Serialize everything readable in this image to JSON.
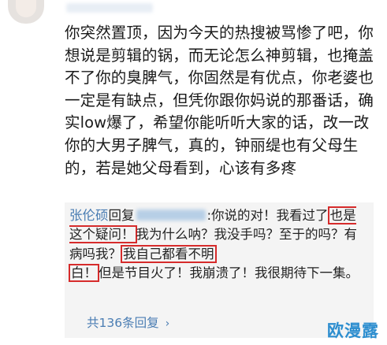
{
  "post": {
    "text": "你突然置顶，因为今天的热搜被骂惨了吧，你想说是剪辑的锅，而无论怎么神剪辑，也掩盖不了你的臭脾气，你固然是有优点，你老婆也一定是有缺点，但凭你跟你妈说的那番话，确实low爆了，希望你能听听大家的话，改一改你的大男子脾气，真的，钟丽缇也有父母生的，若是她父母看到，心该有多疼"
  },
  "reply": {
    "author": "张伦硕",
    "action": "回复",
    "colon_text": ":你说的对！我看过了",
    "highlight1": "也是这个疑问！",
    "middle_text": "我为什么呐？我没手吗？至于的吗？有病吗我？",
    "highlight2_a": "我自己都看不明",
    "line_break_text": "",
    "highlight2_b": "白！",
    "end_text": "但是节目火了！我崩溃了！我很期待下一集。"
  },
  "replies_link": {
    "label": "共136条回复",
    "arrow": "›"
  },
  "watermark": "欧漫露",
  "colors": {
    "link": "#4a7db3",
    "highlight_border": "#d62b2b",
    "reply_bg": "#f4f4f4"
  }
}
